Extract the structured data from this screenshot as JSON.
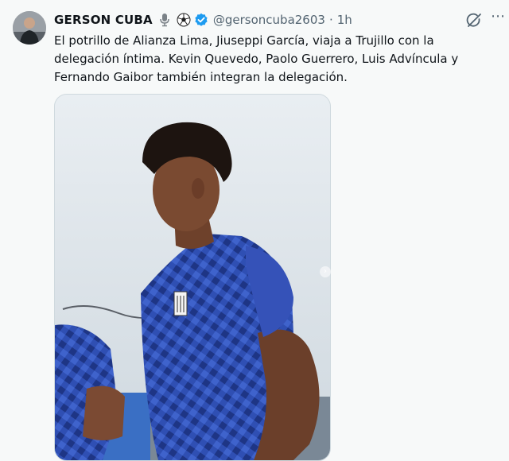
{
  "tweet": {
    "display_name": "GERSON CUBA",
    "handle": "@gersoncuba2603",
    "separator": "·",
    "time": "1h",
    "text": "El potrillo de Alianza Lima, Jiuseppi García, viaja a Trujillo con la delegación íntima. Kevin Quevedo, Paolo Guerrero, Luis Advíncula y Fernando Gaibor también integran la delegación.",
    "more_glyph": "⋯",
    "carousel_glyph": "›"
  },
  "icons": {
    "badges": [
      "microphone-icon",
      "soccer-ball-icon",
      "verified-badge-icon"
    ],
    "grok": "grok-icon",
    "more": "more-icon"
  },
  "colors": {
    "verified": "#1d9bf0",
    "text": "#0f1419",
    "secondary": "#536471",
    "jersey": "#2f4fb3"
  }
}
